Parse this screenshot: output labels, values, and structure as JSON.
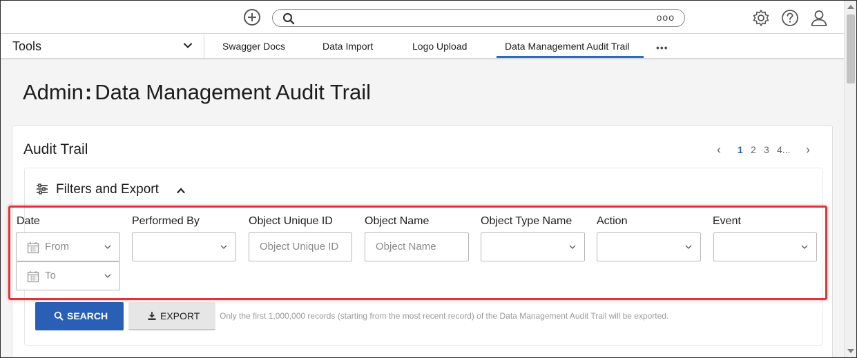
{
  "topbar": {
    "add_icon": "plus-circle-icon",
    "search": {
      "placeholder": "",
      "icon": "search-icon",
      "more_label": "ooo"
    },
    "icons": [
      "gear-icon",
      "help-icon",
      "user-icon"
    ]
  },
  "nav": {
    "tools_label": "Tools",
    "tabs": [
      {
        "label": "Swagger Docs"
      },
      {
        "label": "Data Import"
      },
      {
        "label": "Logo Upload"
      },
      {
        "label": "Data Management Audit Trail",
        "active": true
      }
    ],
    "more_label": "•••"
  },
  "page": {
    "title_prefix": "Admin",
    "title_sep": ":",
    "title_main": "Data Management Audit Trail"
  },
  "card": {
    "title": "Audit Trail",
    "pager": {
      "prev": "‹",
      "pages": [
        "1",
        "2",
        "3",
        "4..."
      ],
      "current": "1",
      "next": "›"
    },
    "filters": {
      "heading": "Filters and Export",
      "fields": [
        {
          "label": "Date",
          "from_placeholder": "From",
          "to_placeholder": "To"
        },
        {
          "label": "Performed By",
          "placeholder": ""
        },
        {
          "label": "Object Unique ID",
          "placeholder": "Object Unique ID"
        },
        {
          "label": "Object Name",
          "placeholder": "Object Name"
        },
        {
          "label": "Object Type Name",
          "placeholder": ""
        },
        {
          "label": "Action",
          "placeholder": ""
        },
        {
          "label": "Event",
          "placeholder": ""
        }
      ]
    },
    "buttons": {
      "search": "SEARCH",
      "export": "EXPORT"
    },
    "export_note": "Only the first 1,000,000 records (starting from the most recent record) of the Data Management Audit Trail will be exported."
  },
  "colors": {
    "accent": "#2a6cb7",
    "button_primary": "#2a5fb6",
    "highlight": "#e0343c"
  }
}
